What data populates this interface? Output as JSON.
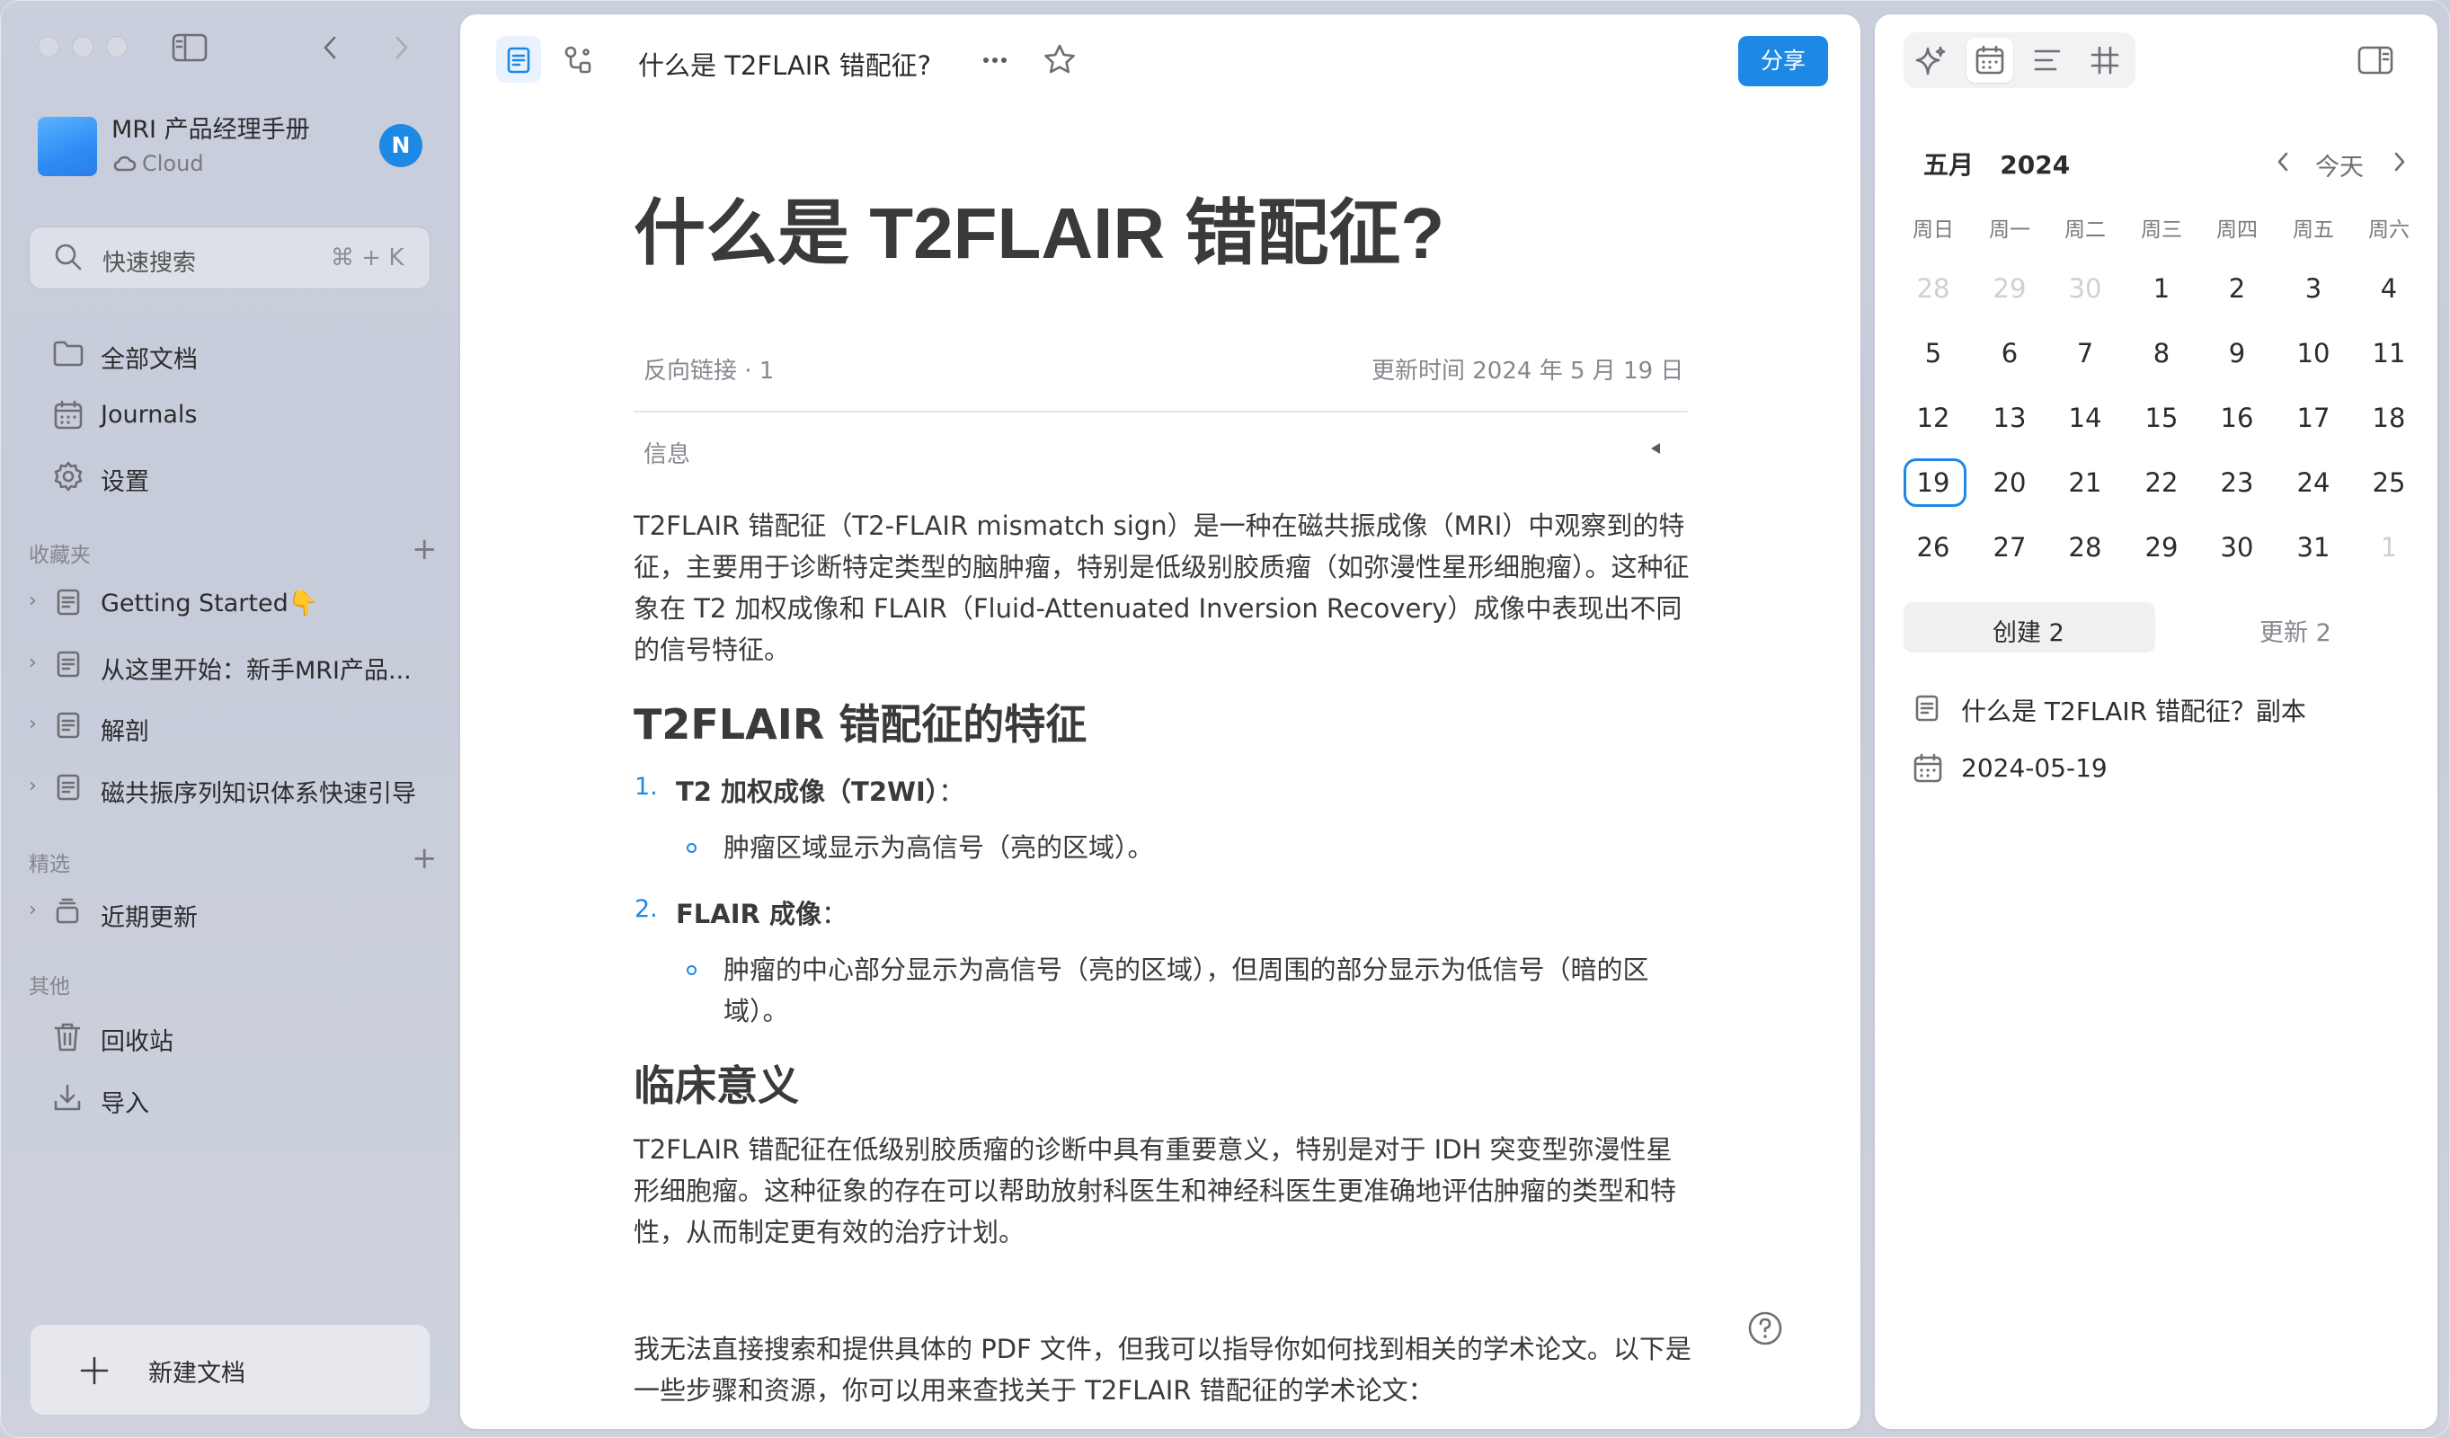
{
  "sidebar": {
    "workspace_name": "MRI 产品经理手册",
    "workspace_sync": "Cloud",
    "avatar_letter": "N",
    "search_placeholder": "快速搜索",
    "search_shortcut": "⌘ + K",
    "nav": [
      {
        "label": "全部文档",
        "icon": "folder-icon"
      },
      {
        "label": "Journals",
        "icon": "calendar-icon"
      },
      {
        "label": "设置",
        "icon": "gear-icon"
      }
    ],
    "favorites_label": "收藏夹",
    "favorites": [
      {
        "label": "Getting Started👇"
      },
      {
        "label": "从这里开始：新手MRI产品..."
      },
      {
        "label": "解剖"
      },
      {
        "label": "磁共振序列知识体系快速引导"
      }
    ],
    "featured_label": "精选",
    "featured": [
      {
        "label": "近期更新"
      }
    ],
    "other_label": "其他",
    "other": [
      {
        "label": "回收站",
        "icon": "trash-icon"
      },
      {
        "label": "导入",
        "icon": "import-icon"
      }
    ],
    "new_doc_label": "新建文档"
  },
  "header": {
    "doc_title": "什么是 T2FLAIR 错配征?",
    "share_label": "分享"
  },
  "doc": {
    "title": "什么是 T2FLAIR 错配征?",
    "backlinks": "反向链接 · 1",
    "updated": "更新时间 2024 年 5 月 19 日",
    "info_label": "信息",
    "intro": "T2FLAIR 错配征（T2-FLAIR mismatch sign）是一种在磁共振成像（MRI）中观察到的特征，主要用于诊断特定类型的脑肿瘤，特别是低级别胶质瘤（如弥漫性星形细胞瘤）。这种征象在 T2 加权成像和 FLAIR（Fluid-Attenuated Inversion Recovery）成像中表现出不同的信号特征。",
    "section1_heading": "T2FLAIR 错配征的特征",
    "list": [
      {
        "num": "1.",
        "title": "T2 加权成像（T2WI）",
        "suffix": "：",
        "sub": "肿瘤区域显示为高信号（亮的区域）。"
      },
      {
        "num": "2.",
        "title": "FLAIR 成像",
        "suffix": "：",
        "sub": "肿瘤的中心部分显示为高信号（亮的区域），但周围的部分显示为低信号（暗的区域）。"
      }
    ],
    "section2_heading": "临床意义",
    "clinical": "T2FLAIR 错配征在低级别胶质瘤的诊断中具有重要意义，特别是对于 IDH 突变型弥漫性星形细胞瘤。这种征象的存在可以帮助放射科医生和神经科医生更准确地评估肿瘤的类型和特性，从而制定更有效的治疗计划。",
    "closing": "我无法直接搜索和提供具体的 PDF 文件，但我可以指导你如何找到相关的学术论文。以下是一些步骤和资源，你可以用来查找关于 T2FLAIR 错配征的学术论文："
  },
  "calendar": {
    "month": "五月",
    "year": "2024",
    "today_label": "今天",
    "weekdays": [
      "周日",
      "周一",
      "周二",
      "周三",
      "周四",
      "周五",
      "周六"
    ],
    "weeks": [
      [
        "28",
        "29",
        "30",
        "1",
        "2",
        "3",
        "4"
      ],
      [
        "5",
        "6",
        "7",
        "8",
        "9",
        "10",
        "11"
      ],
      [
        "12",
        "13",
        "14",
        "15",
        "16",
        "17",
        "18"
      ],
      [
        "19",
        "20",
        "21",
        "22",
        "23",
        "24",
        "25"
      ],
      [
        "26",
        "27",
        "28",
        "29",
        "30",
        "31",
        "1"
      ]
    ],
    "selected_day": "19",
    "created_label": "创建 2",
    "updated_label": "更新 2",
    "entries": [
      {
        "label": "什么是 T2FLAIR 错配征？副本",
        "icon": "document-icon"
      },
      {
        "label": "2024-05-19",
        "icon": "calendar-icon"
      }
    ]
  },
  "colors": {
    "accent": "#1e88e5",
    "sidebar_bg": "#c9cfdc"
  }
}
